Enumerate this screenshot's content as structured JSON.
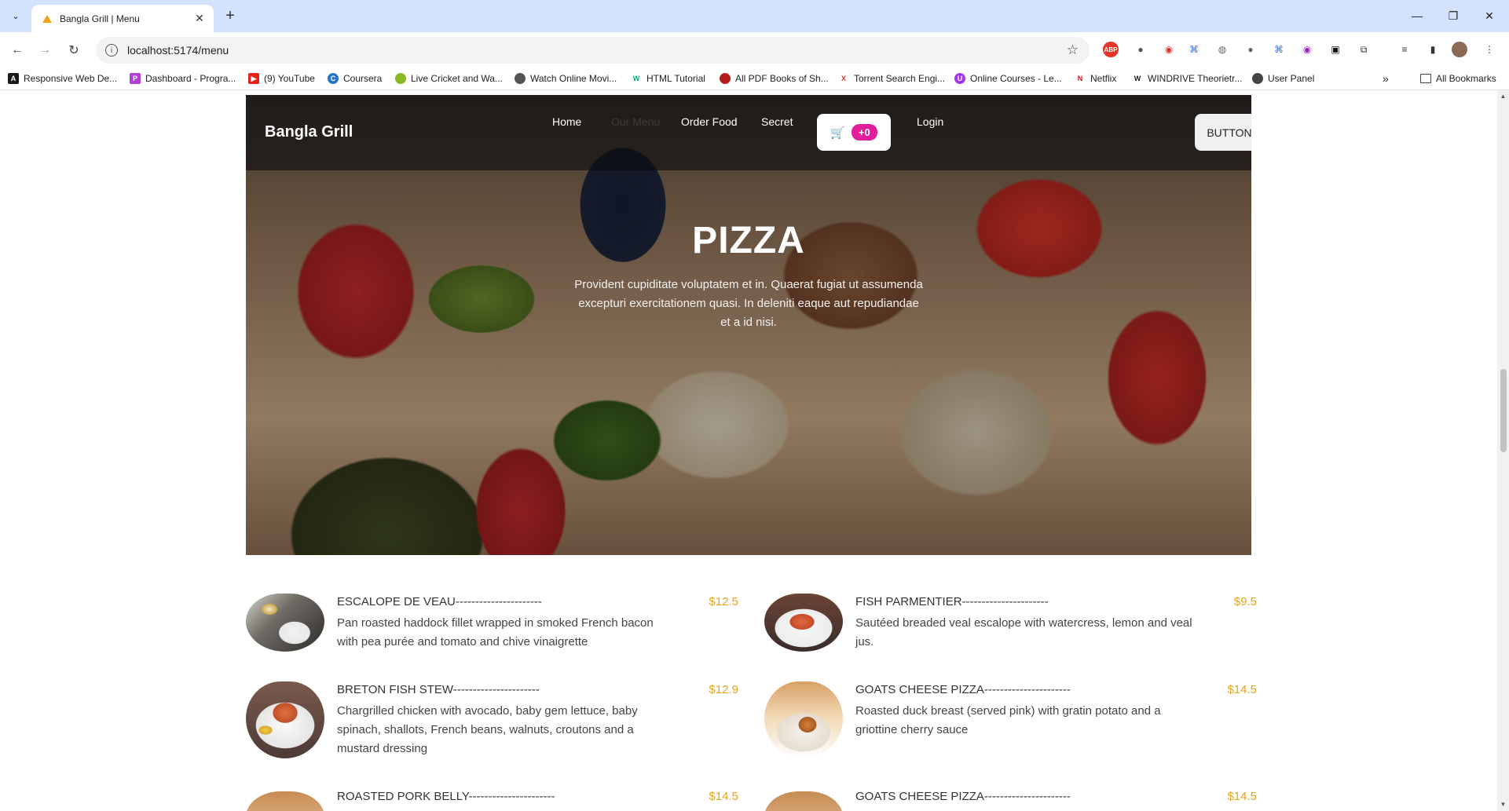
{
  "browser": {
    "tab_title": "Bangla Grill | Menu",
    "url": "localhost:5174/menu",
    "bookmarks": [
      {
        "label": "Responsive Web De...",
        "color": "#1a1a1a",
        "glyph": "A"
      },
      {
        "label": "Dashboard - Progra...",
        "color": "#b23fd0",
        "glyph": "P"
      },
      {
        "label": "(9) YouTube",
        "color": "#e62117",
        "glyph": "▶"
      },
      {
        "label": "Coursera",
        "color": "#2a73cc",
        "glyph": "C"
      },
      {
        "label": "Live Cricket and Wa...",
        "color": "#8ab820",
        "glyph": "●"
      },
      {
        "label": "Watch Online Movi...",
        "color": "#555555",
        "glyph": "✹"
      },
      {
        "label": "HTML Tutorial",
        "color": "#04aa6d",
        "glyph": "W"
      },
      {
        "label": "All PDF Books of Sh...",
        "color": "#b01e1e",
        "glyph": "●"
      },
      {
        "label": "Torrent Search Engi...",
        "color": "#d9361f",
        "glyph": "X"
      },
      {
        "label": "Online Courses - Le...",
        "color": "#a435f0",
        "glyph": "U"
      },
      {
        "label": "Netflix",
        "color": "#e50914",
        "glyph": "N"
      },
      {
        "label": "WINDRIVE Theorietr...",
        "color": "#1a1a1a",
        "glyph": "W"
      },
      {
        "label": "User Panel",
        "color": "#444444",
        "glyph": "◐"
      }
    ],
    "all_bookmarks": "All Bookmarks"
  },
  "nav": {
    "brand": "Bangla Grill",
    "links": [
      "Home",
      "Our Menu",
      "Order Food",
      "Secret"
    ],
    "cart_badge": "+0",
    "login": "Login",
    "button": "BUTTON"
  },
  "hero": {
    "title": "PIZZA",
    "description": "Provident cupiditate voluptatem et in. Quaerat fugiat ut assumenda excepturi exercitationem quasi. In deleniti eaque aut repudiandae et a id nisi."
  },
  "menu": [
    {
      "name": "ESCALOPE DE VEAU----------------------",
      "price": "$12.5",
      "description": "Pan roasted haddock fillet wrapped in smoked French bacon with pea purée and tomato and chive vinaigrette"
    },
    {
      "name": "FISH PARMENTIER----------------------",
      "price": "$9.5",
      "description": "Sautéed breaded veal escalope with watercress, lemon and veal jus."
    },
    {
      "name": "BRETON FISH STEW----------------------",
      "price": "$12.9",
      "description": "Chargrilled chicken with avocado, baby gem lettuce, baby spinach, shallots, French beans, walnuts, croutons and a mustard dressing"
    },
    {
      "name": "GOATS CHEESE PIZZA----------------------",
      "price": "$14.5",
      "description": "Roasted duck breast (served pink) with gratin potato and a griottine cherry sauce"
    },
    {
      "name": "ROASTED PORK BELLY----------------------",
      "price": "$14.5",
      "description": ""
    },
    {
      "name": "GOATS CHEESE PIZZA----------------------",
      "price": "$14.5",
      "description": ""
    }
  ],
  "colors": {
    "price": "#e8a417",
    "cart_badge": "#e21e9c"
  }
}
